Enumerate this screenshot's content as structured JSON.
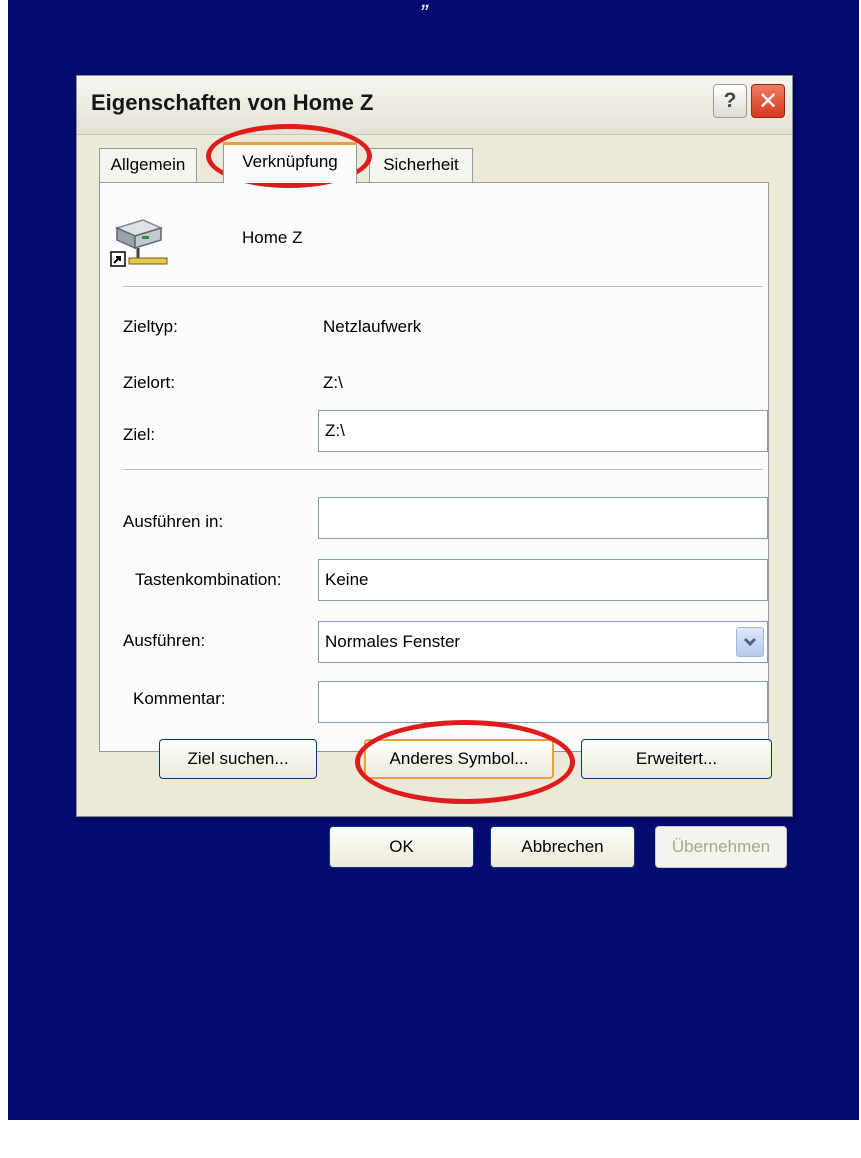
{
  "caption": "„ “",
  "window": {
    "title": "Eigenschaften von Home Z",
    "help_label": "?",
    "close_label": "✕"
  },
  "tabs": [
    "Allgemein",
    "Verknüpfung",
    "Sicherheit"
  ],
  "active_tab": "Verknüpfung",
  "shortcut": {
    "name": "Home Z",
    "icon": "network-drive-shortcut-icon"
  },
  "fields": {
    "zieltyp": {
      "label": "Zieltyp:",
      "value": "Netzlaufwerk"
    },
    "zielort": {
      "label": "Zielort:",
      "value": "Z:\\"
    },
    "ziel": {
      "label": "Ziel:",
      "value": "Z:\\"
    },
    "ausfuehren_in": {
      "label": "Ausführen in:",
      "value": ""
    },
    "tastenkombination": {
      "label": "Tastenkombination:",
      "value": "Keine"
    },
    "ausfuehren": {
      "label": "Ausführen:",
      "value": "Normales Fenster"
    },
    "kommentar": {
      "label": "Kommentar:",
      "value": ""
    }
  },
  "buttons": {
    "ziel_suchen": "Ziel suchen...",
    "anderes_symbol": "Anderes Symbol...",
    "erweitert": "Erweitert...",
    "ok": "OK",
    "abbrechen": "Abbrechen",
    "uebernehmen": "Übernehmen"
  },
  "colors": {
    "background": "#050b6e",
    "highlight_ring": "#e01b1b"
  }
}
